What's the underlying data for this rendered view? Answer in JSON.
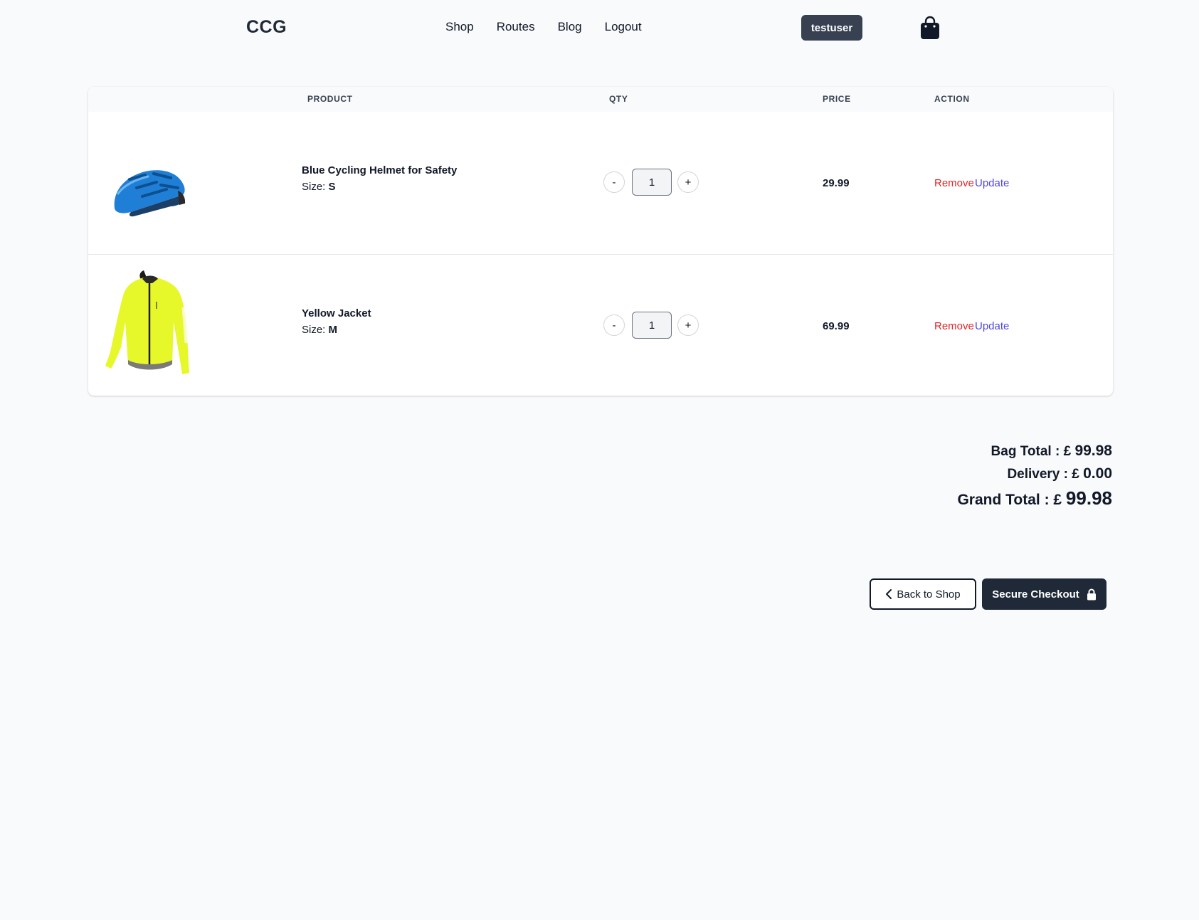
{
  "header": {
    "logo": "CCG",
    "nav": [
      "Shop",
      "Routes",
      "Blog",
      "Logout"
    ],
    "username": "testuser",
    "bag_icon": "shopping-bag-icon"
  },
  "table": {
    "columns": [
      "PRODUCT",
      "QTY",
      "PRICE",
      "ACTION"
    ],
    "items": [
      {
        "name": "Blue Cycling Helmet for Safety",
        "size_label": "Size:",
        "size": "S",
        "qty": "1",
        "minus": "-",
        "plus": "+",
        "price": "29.99",
        "remove": "Remove",
        "update": "Update",
        "image": "blue-helmet"
      },
      {
        "name": "Yellow Jacket",
        "size_label": "Size:",
        "size": "M",
        "qty": "1",
        "minus": "-",
        "plus": "+",
        "price": "69.99",
        "remove": "Remove",
        "update": "Update",
        "image": "yellow-jacket"
      }
    ]
  },
  "totals": {
    "bag_label": "Bag Total : £",
    "bag_amount": "99.98",
    "delivery_label": "Delivery : £",
    "delivery_amount": "0.00",
    "grand_label": "Grand Total : £",
    "grand_amount": "99.98"
  },
  "buttons": {
    "back": "Back to Shop",
    "checkout": "Secure Checkout"
  },
  "colors": {
    "remove": "#dc2626",
    "update": "#4f46e5",
    "dark": "#1f2937",
    "user_button": "#374151"
  }
}
